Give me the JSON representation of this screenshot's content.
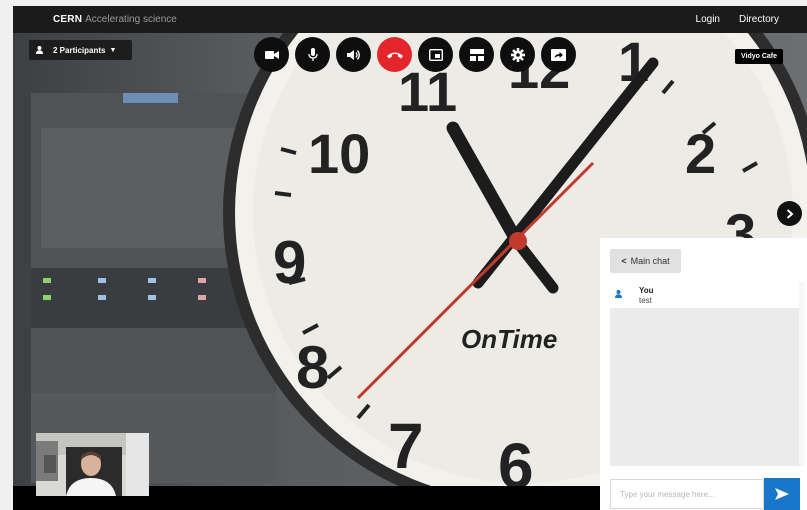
{
  "header": {
    "brand_name": "CERN",
    "brand_tagline": "Accelerating science",
    "links": [
      "Login",
      "Directory"
    ]
  },
  "call": {
    "participants_label": "2 Participants",
    "room_name": "Vidyo Cafe",
    "controls": [
      {
        "icon": "camera-icon",
        "name": "camera-button"
      },
      {
        "icon": "microphone-icon",
        "name": "microphone-button"
      },
      {
        "icon": "speaker-icon",
        "name": "speaker-button"
      },
      {
        "icon": "hang-up-icon",
        "name": "hang-up-button",
        "color": "#e3262b"
      },
      {
        "icon": "picture-in-picture-icon",
        "name": "pip-button"
      },
      {
        "icon": "layout-icon",
        "name": "layout-button"
      },
      {
        "icon": "gear-icon",
        "name": "settings-button"
      },
      {
        "icon": "share-screen-icon",
        "name": "share-screen-button"
      }
    ],
    "remote_video": {
      "clock_text": "OnTime",
      "clock_numerals": [
        "6",
        "7",
        "8",
        "9",
        "10",
        "11",
        "12",
        "1",
        "2",
        "3"
      ]
    }
  },
  "chat": {
    "tab_label": "Main chat",
    "messages": [
      {
        "sender": "You",
        "text": "test"
      }
    ],
    "input_placeholder": "Type your message here...",
    "input_value": "",
    "send_icon": "send-arrow-icon",
    "accent_color": "#1877c9"
  }
}
